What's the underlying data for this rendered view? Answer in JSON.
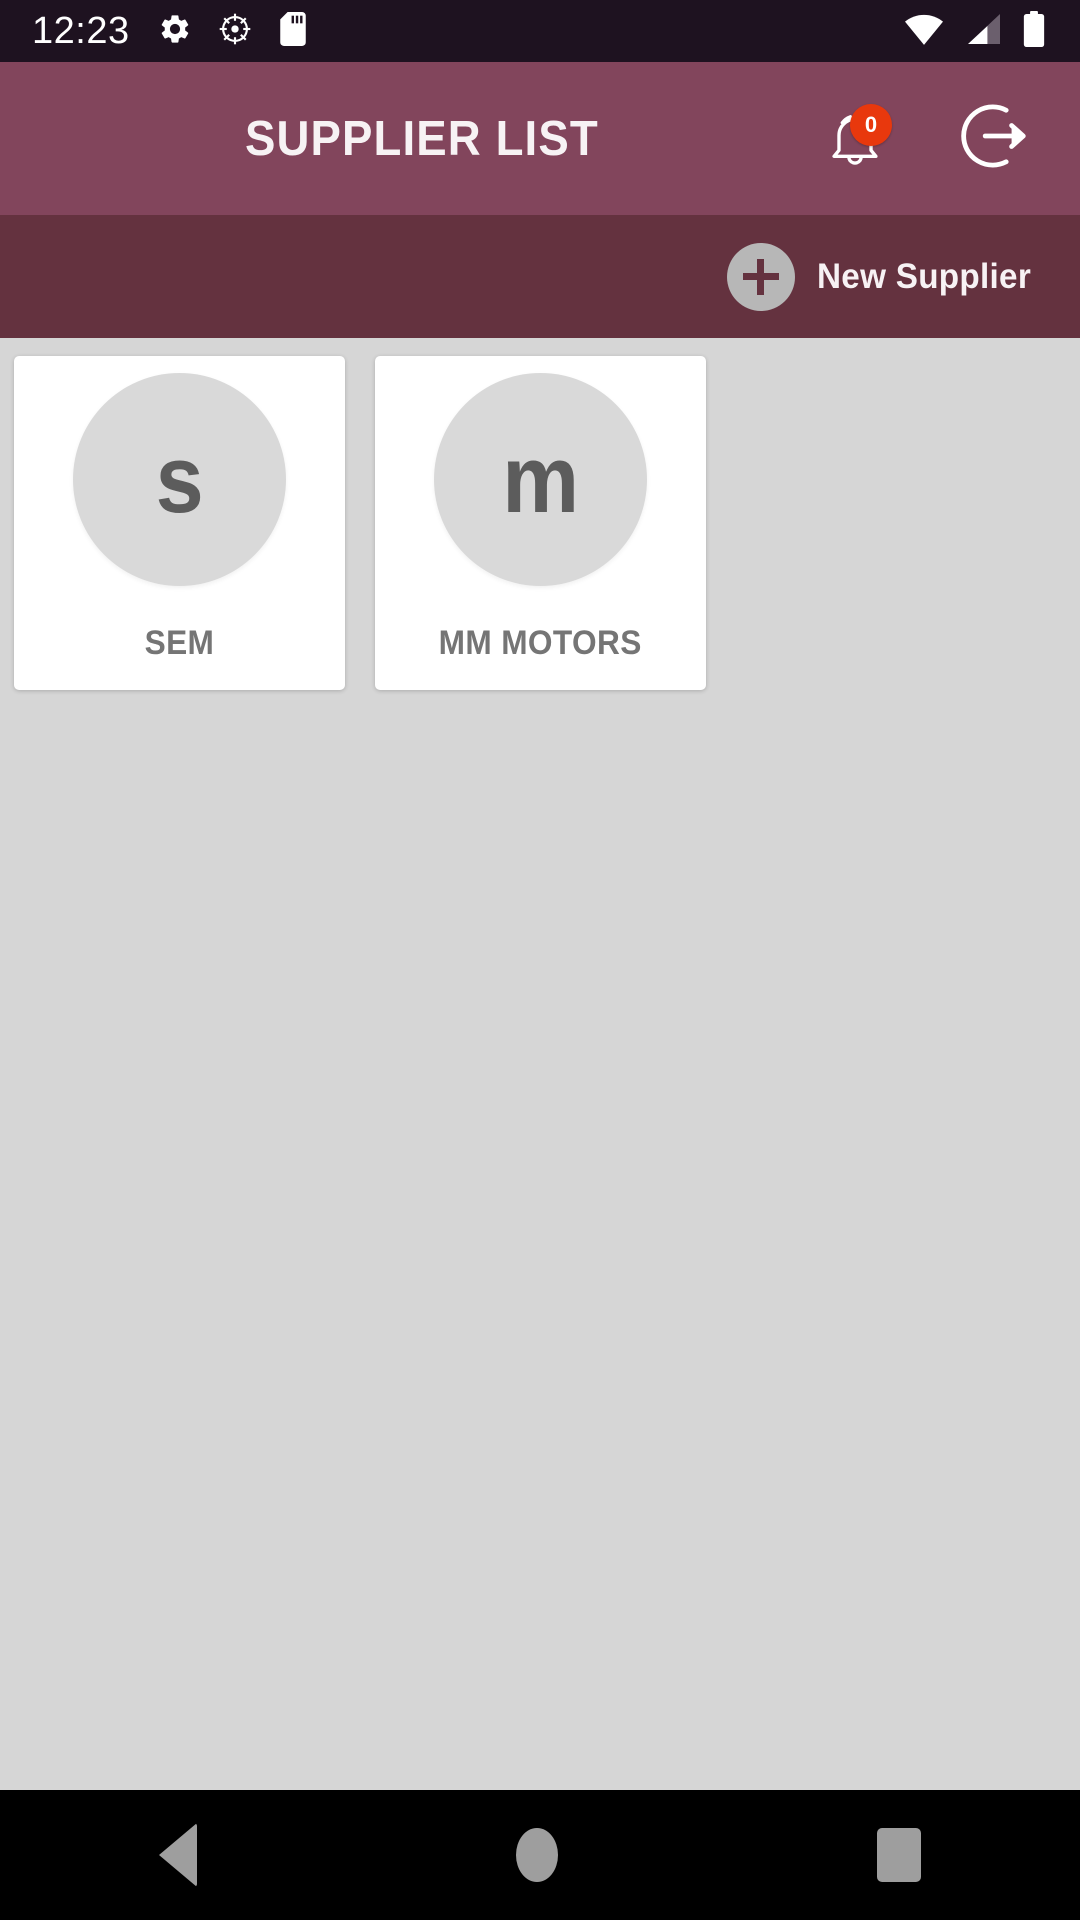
{
  "status_bar": {
    "clock": "12:23",
    "left_icons": [
      "gear-icon",
      "ship-wheel-icon",
      "sd-card-icon"
    ],
    "right_icons": [
      "wifi-icon",
      "cellular-signal-icon",
      "battery-icon"
    ],
    "background_color": "#1e1220",
    "foreground_color": "#ffffff"
  },
  "app_bar": {
    "title": "SUPPLIER LIST",
    "background_color": "#82455c",
    "title_color": "#f7f2f4",
    "notifications": {
      "icon": "bell-icon",
      "badge_count": "0",
      "badge_color": "#e8380d"
    },
    "logout": {
      "icon": "logout-icon",
      "label": "Logout"
    }
  },
  "sub_bar": {
    "background_color": "#64323f",
    "new_supplier": {
      "label": "New Supplier",
      "icon": "plus-circle-icon",
      "circle_color": "#b7b7b7"
    }
  },
  "content": {
    "background_color": "#d6d6d6",
    "suppliers": [
      {
        "name": "SEM",
        "avatar_letter": "s"
      },
      {
        "name": "MM MOTORS",
        "avatar_letter": "m"
      }
    ]
  },
  "nav_bar": {
    "background_color": "#000000",
    "buttons": [
      {
        "name": "back",
        "icon": "back-triangle-icon"
      },
      {
        "name": "home",
        "icon": "home-circle-icon"
      },
      {
        "name": "recents",
        "icon": "recents-square-icon"
      }
    ]
  }
}
